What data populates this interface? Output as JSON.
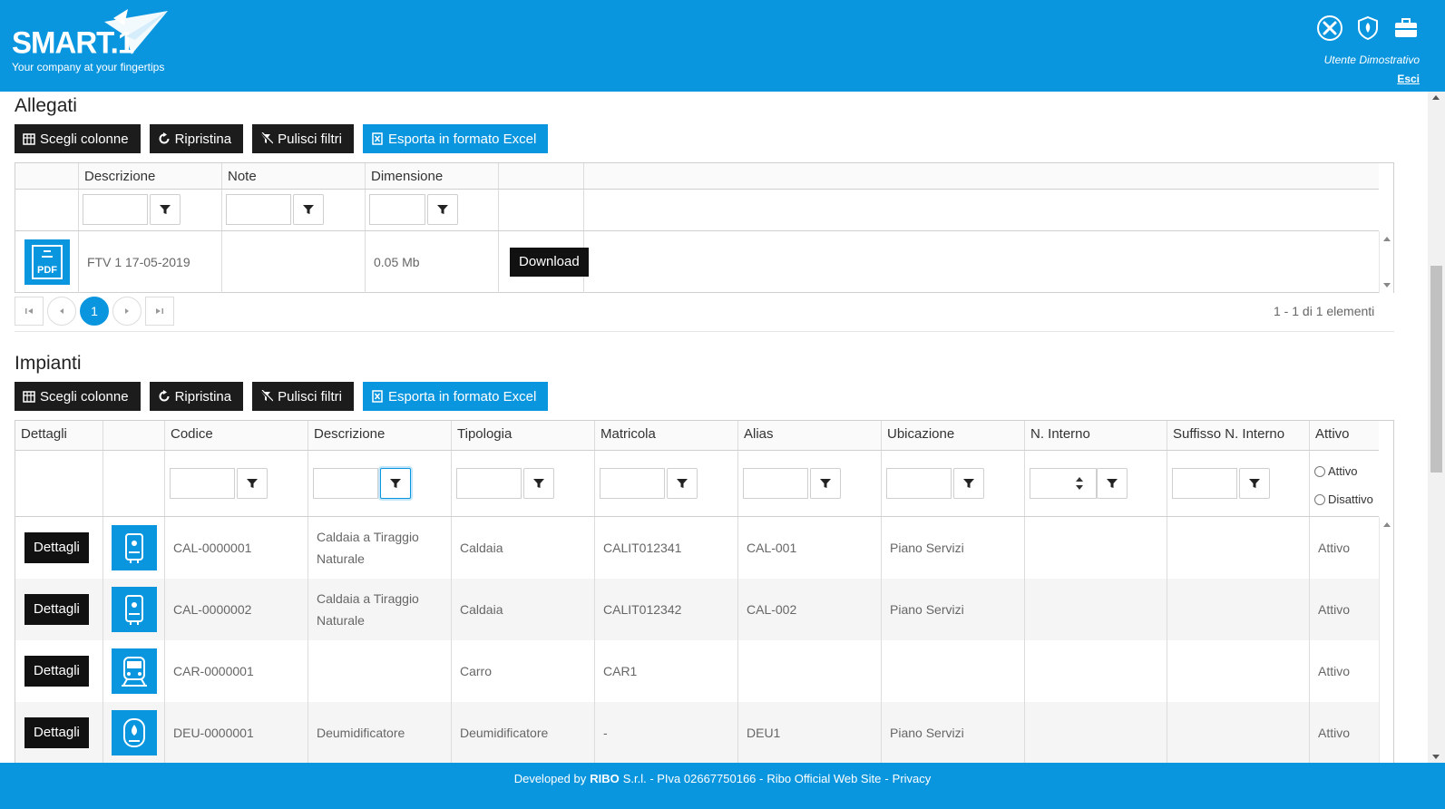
{
  "header": {
    "logo_text": "SMART.1",
    "tagline": "Your company at your fingertips",
    "icons": [
      "tools-icon",
      "shield-icon",
      "briefcase-icon"
    ],
    "user_name": "Utente Dimostrativo",
    "logout_label": "Esci"
  },
  "toolbar": {
    "choose_columns": "Scegli colonne",
    "restore": "Ripristina",
    "clear_filters": "Pulisci filtri",
    "export_excel": "Esporta in formato Excel"
  },
  "allegati": {
    "title": "Allegati",
    "columns": [
      "Descrizione",
      "Note",
      "Dimensione"
    ],
    "rows": [
      {
        "icon": "pdf-icon",
        "icon_text": "PDF",
        "descrizione": "FTV 1 17-05-2019",
        "note": "",
        "dimensione": "0.05 Mb",
        "action": "Download"
      }
    ],
    "pager": {
      "current_page": "1",
      "info": "1 - 1 di 1 elementi"
    }
  },
  "impianti": {
    "title": "Impianti",
    "columns": [
      "Dettagli",
      "",
      "Codice",
      "Descrizione",
      "Tipologia",
      "Matricola",
      "Alias",
      "Ubicazione",
      "N. Interno",
      "Suffisso N. Interno",
      "Attivo"
    ],
    "attivo_filter": {
      "option_active": "Attivo",
      "option_inactive": "Disattivo"
    },
    "details_label": "Dettagli",
    "rows": [
      {
        "icon": "boiler-icon",
        "codice": "CAL-0000001",
        "descrizione": "Caldaia a Tiraggio Naturale",
        "tipologia": "Caldaia",
        "matricola": "CALIT012341",
        "alias": "CAL-001",
        "ubicazione": "Piano Servizi",
        "n_interno": "",
        "suffisso": "",
        "attivo": "Attivo"
      },
      {
        "icon": "boiler-icon",
        "codice": "CAL-0000002",
        "descrizione": "Caldaia a Tiraggio Naturale",
        "tipologia": "Caldaia",
        "matricola": "CALIT012342",
        "alias": "CAL-002",
        "ubicazione": "Piano Servizi",
        "n_interno": "",
        "suffisso": "",
        "attivo": "Attivo"
      },
      {
        "icon": "train-icon",
        "codice": "CAR-0000001",
        "descrizione": "",
        "tipologia": "Carro",
        "matricola": "CAR1",
        "alias": "",
        "ubicazione": "",
        "n_interno": "",
        "suffisso": "",
        "attivo": "Attivo"
      },
      {
        "icon": "dehumidifier-icon",
        "codice": "DEU-0000001",
        "descrizione": "Deumidificatore",
        "tipologia": "Deumidificatore",
        "matricola": "-",
        "alias": "DEU1",
        "ubicazione": "Piano Servizi",
        "n_interno": "",
        "suffisso": "",
        "attivo": "Attivo"
      }
    ]
  },
  "footer": {
    "developed_by": "Developed by",
    "company": "RIBO",
    "company_suffix": "S.r.l. - PIva 02667750166 -",
    "site_link": "Ribo Official Web Site",
    "separator": "-",
    "privacy_link": "Privacy"
  }
}
